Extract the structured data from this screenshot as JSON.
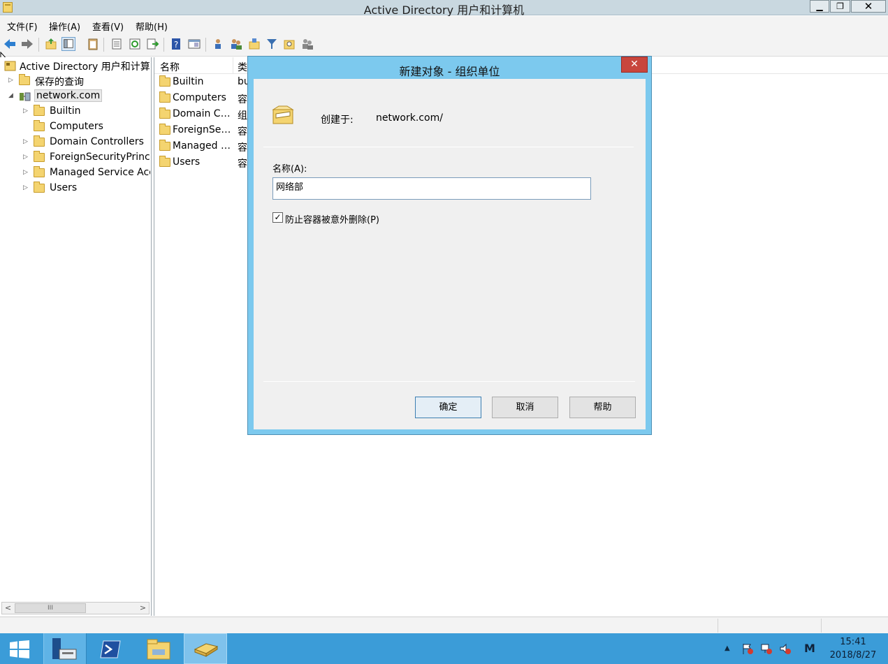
{
  "window": {
    "title": "Active Directory 用户和计算机",
    "min": "▁",
    "max": "❐",
    "close": "✕"
  },
  "menu": [
    "文件(F)",
    "操作(A)",
    "查看(V)",
    "帮助(H)"
  ],
  "toolbar_icons": [
    "back-arrow-icon",
    "forward-arrow-icon",
    "up-folder-icon",
    "console-tree-icon",
    "clipboard-icon",
    "properties-icon",
    "refresh-icon",
    "export-list-icon",
    "help-icon",
    "details-pane-icon",
    "new-user-icon",
    "new-group-icon",
    "new-ou-icon",
    "filter-icon",
    "find-icon",
    "add-to-group-icon"
  ],
  "tree": {
    "root": "Active Directory 用户和计算机",
    "items": [
      {
        "label": "保存的查询",
        "level": 1,
        "arrow": "▷"
      },
      {
        "label": "network.com",
        "level": 1,
        "arrow": "◢"
      },
      {
        "label": "Builtin",
        "level": 2,
        "arrow": "▷"
      },
      {
        "label": "Computers",
        "level": 2,
        "arrow": ""
      },
      {
        "label": "Domain Controllers",
        "level": 2,
        "arrow": "▷"
      },
      {
        "label": "ForeignSecurityPrincipals",
        "level": 2,
        "arrow": "▷"
      },
      {
        "label": "Managed Service Accounts",
        "level": 2,
        "arrow": "▷"
      },
      {
        "label": "Users",
        "level": 2,
        "arrow": "▷"
      }
    ],
    "scroll_left": "<",
    "scroll_thumb": "III",
    "scroll_right": ">"
  },
  "list": {
    "columns": [
      "名称",
      "类型"
    ],
    "rows": [
      {
        "name": "Builtin",
        "type": "builtinDomain"
      },
      {
        "name": "Computers",
        "type": "容器"
      },
      {
        "name": "Domain Controllers",
        "type": "组织单位"
      },
      {
        "name": "ForeignSecurityPrincipals",
        "type": "容器"
      },
      {
        "name": "Managed Service Accounts",
        "type": "容器"
      },
      {
        "name": "Users",
        "type": "容器"
      }
    ]
  },
  "dialog": {
    "title": "新建对象 - 组织单位",
    "close": "✕",
    "created_in_label": "创建于:",
    "created_in_value": "network.com/",
    "name_label": "名称(A):",
    "name_value": "网络部",
    "protect_checked": "✓",
    "protect_label": "防止容器被意外删除(P)",
    "ok": "确定",
    "cancel": "取消",
    "help": "帮助"
  },
  "taskbar": {
    "tray_arrow": "▲",
    "ime": "M",
    "time": "15:41",
    "date": "2018/8/27"
  },
  "colors": {
    "taskbar": "#3b9cd8",
    "dialog_frame": "#7cc9ee",
    "close_red": "#c8463d"
  }
}
